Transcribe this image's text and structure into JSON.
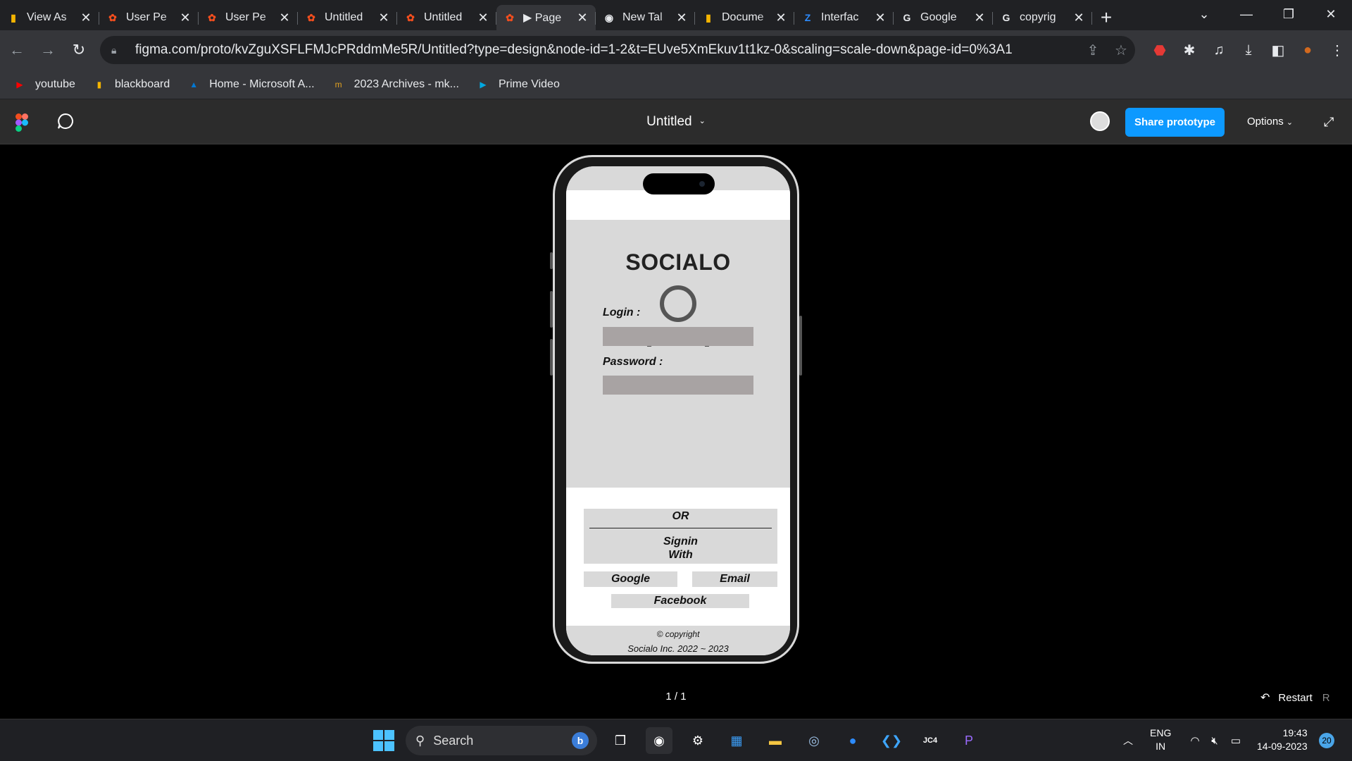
{
  "browser": {
    "tabs": [
      {
        "title": "View As",
        "icon": "bar-chart-icon",
        "active": false
      },
      {
        "title": "User Pe",
        "icon": "figma-icon",
        "active": false
      },
      {
        "title": "User Pe",
        "icon": "figma-icon",
        "active": false
      },
      {
        "title": "Untitled",
        "icon": "figma-icon",
        "active": false
      },
      {
        "title": "Untitled",
        "icon": "figma-icon",
        "active": false
      },
      {
        "title": "▶ Page",
        "icon": "figma-icon",
        "active": true
      },
      {
        "title": "New Tal",
        "icon": "chrome-icon",
        "active": false
      },
      {
        "title": "Docume",
        "icon": "bar-chart-icon",
        "active": false
      },
      {
        "title": "Interfac",
        "icon": "z-icon",
        "active": false
      },
      {
        "title": "Google",
        "icon": "google-icon",
        "active": false
      },
      {
        "title": "copyrig",
        "icon": "google-icon",
        "active": false
      }
    ],
    "url": "figma.com/proto/kvZguXSFLFMJcPRddmMe5R/Untitled?type=design&node-id=1-2&t=EUve5XmEkuv1t1kz-0&scaling=scale-down&page-id=0%3A1",
    "bookmarks": [
      {
        "label": "youtube",
        "icon": "youtube-icon"
      },
      {
        "label": "blackboard",
        "icon": "bar-chart-icon"
      },
      {
        "label": "Home - Microsoft A...",
        "icon": "azure-icon"
      },
      {
        "label": "2023 Archives - mk...",
        "icon": "mk-icon"
      },
      {
        "label": "Prime Video",
        "icon": "prime-video-icon"
      }
    ]
  },
  "figma": {
    "file_title": "Untitled",
    "share_label": "Share prototype",
    "options_label": "Options",
    "pager": "1 / 1",
    "restart_label": "Restart",
    "restart_key": "R"
  },
  "prototype": {
    "brand": "SOCIALO",
    "login_label": "Login :",
    "password_label": "Password :",
    "or_label": "OR",
    "signin_line1": "Signin",
    "signin_line2": "With",
    "google_label": "Google",
    "email_label": "Email",
    "facebook_label": "Facebook",
    "copyright_line1": "© copyright",
    "copyright_line2": "Socialo Inc. 2022 ~ 2023"
  },
  "taskbar": {
    "search_label": "Search",
    "lang_line1": "ENG",
    "lang_line2": "IN",
    "time": "19:43",
    "date": "14-09-2023",
    "notification_count": "20",
    "app_badge": "JC4"
  },
  "colors": {
    "accent": "#0d99ff",
    "phone_panel": "#d9d9d9",
    "field": "#a8a3a3"
  }
}
